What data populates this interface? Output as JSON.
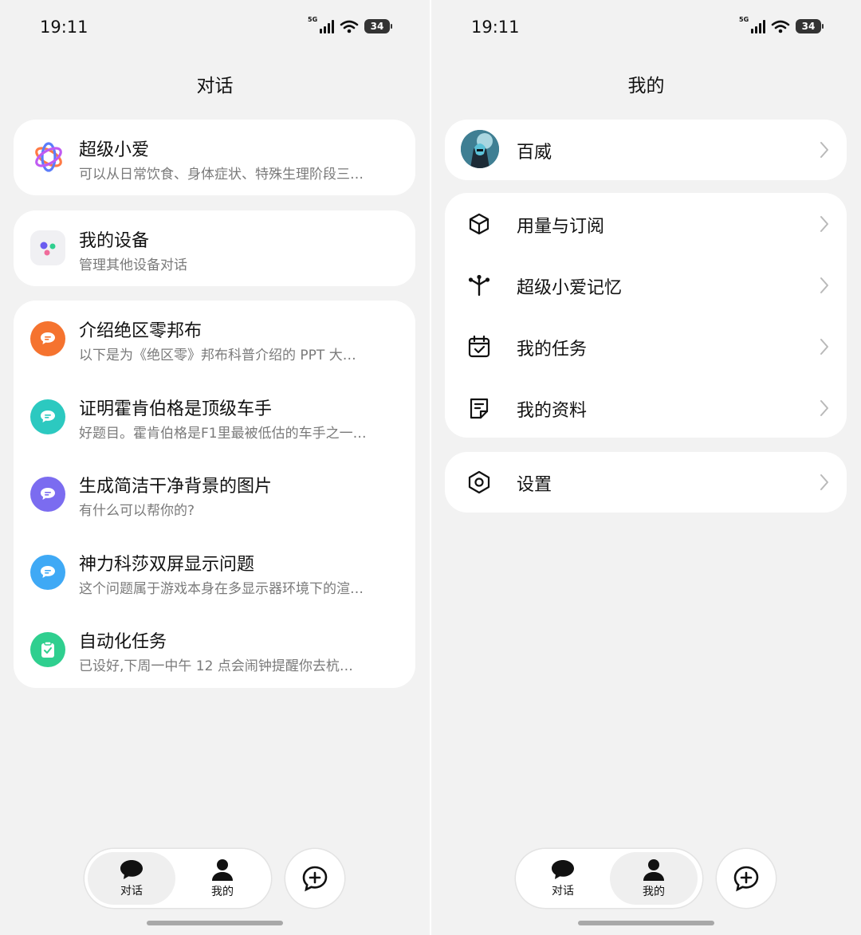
{
  "status": {
    "time": "19:11",
    "network": "5G",
    "battery": "34"
  },
  "chats_screen": {
    "title": "对话",
    "pinned": [
      {
        "title": "超级小爱",
        "subtitle": "可以从日常饮食、身体症状、特殊生理阶段三…",
        "icon": "xiaoai-logo-icon"
      },
      {
        "title": "我的设备",
        "subtitle": "管理其他设备对话",
        "icon": "devices-icon"
      }
    ],
    "conversations": [
      {
        "title": "介绍绝区零邦布",
        "subtitle": "以下是为《绝区零》邦布科普介绍的 PPT 大…",
        "icon": "chat-bubble-icon",
        "color": "#f5732f"
      },
      {
        "title": "证明霍肯伯格是顶级车手",
        "subtitle": "好题目。霍肯伯格是F1里最被低估的车手之一…",
        "icon": "chat-bubble-icon",
        "color": "#2cc9c0"
      },
      {
        "title": "生成简洁干净背景的图片",
        "subtitle": "有什么可以帮你的?",
        "icon": "chat-bubble-icon",
        "color": "#7b6cf0"
      },
      {
        "title": "神力科莎双屏显示问题",
        "subtitle": "这个问题属于游戏本身在多显示器环境下的渲…",
        "icon": "chat-bubble-icon",
        "color": "#3fa9f5"
      },
      {
        "title": "自动化任务",
        "subtitle": "已设好,下周一中午 12 点会闹钟提醒你去杭…",
        "icon": "clipboard-check-icon",
        "color": "#2fcf8f"
      }
    ]
  },
  "profile_screen": {
    "title": "我的",
    "user": {
      "name": "百威"
    },
    "menu": [
      {
        "label": "用量与订阅",
        "icon": "cube-icon"
      },
      {
        "label": "超级小爱记忆",
        "icon": "memory-branch-icon"
      },
      {
        "label": "我的任务",
        "icon": "calendar-check-icon"
      },
      {
        "label": "我的资料",
        "icon": "document-icon"
      }
    ],
    "settings": {
      "label": "设置",
      "icon": "hexagon-gear-icon"
    }
  },
  "nav": {
    "chats_label": "对话",
    "me_label": "我的"
  },
  "colors": {
    "background": "#f2f2f2",
    "card": "#ffffff",
    "subtitle": "#7a7a7a"
  }
}
